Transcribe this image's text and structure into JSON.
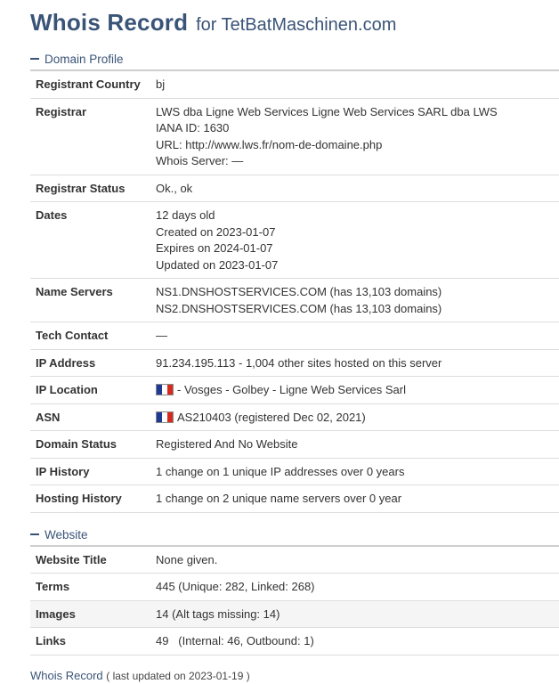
{
  "header": {
    "title": "Whois Record",
    "subtitle": "for TetBatMaschinen.com"
  },
  "domain_profile": {
    "heading": "Domain Profile",
    "rows": {
      "registrant_country": {
        "label": "Registrant Country",
        "value": "bj"
      },
      "registrar": {
        "label": "Registrar",
        "lines": [
          "LWS dba Ligne Web Services Ligne Web Services SARL dba LWS",
          "IANA ID: 1630",
          "URL: http://www.lws.fr/nom-de-domaine.php",
          "Whois Server: —"
        ]
      },
      "registrar_status": {
        "label": "Registrar Status",
        "value": "Ok., ok"
      },
      "dates": {
        "label": "Dates",
        "lines": [
          "12 days old",
          "Created on 2023-01-07",
          "Expires on 2024-01-07",
          "Updated on 2023-01-07"
        ]
      },
      "name_servers": {
        "label": "Name Servers",
        "lines": [
          "NS1.DNSHOSTSERVICES.COM (has 13,103 domains)",
          "NS2.DNSHOSTSERVICES.COM (has 13,103 domains)"
        ]
      },
      "tech_contact": {
        "label": "Tech Contact",
        "value": "—"
      },
      "ip_address": {
        "label": "IP Address",
        "value": "91.234.195.113 - 1,004 other sites hosted on this server"
      },
      "ip_location": {
        "label": "IP Location",
        "value": "- Vosges - Golbey - Ligne Web Services Sarl",
        "flag": "france-flag-icon"
      },
      "asn": {
        "label": "ASN",
        "value": "AS210403 (registered Dec 02, 2021)",
        "flag": "france-flag-icon"
      },
      "domain_status": {
        "label": "Domain Status",
        "value": "Registered And No Website"
      },
      "ip_history": {
        "label": "IP History",
        "value": "1 change on 1 unique IP addresses over 0 years"
      },
      "hosting_history": {
        "label": "Hosting History",
        "value": "1 change on 2 unique name servers over 0 year"
      }
    }
  },
  "website": {
    "heading": "Website",
    "rows": {
      "website_title": {
        "label": "Website Title",
        "value": "None given."
      },
      "terms": {
        "label": "Terms",
        "value": "445 (Unique: 282, Linked: 268)"
      },
      "images": {
        "label": "Images",
        "value": "14 (Alt tags missing: 14)"
      },
      "links": {
        "label": "Links",
        "value": "49   (Internal: 46, Outbound: 1)"
      }
    }
  },
  "footer": {
    "link": "Whois Record",
    "meta": "( last updated on 2023-01-19 )"
  },
  "colors": {
    "heading": "#3a5478",
    "flag_blue": "#1f3a93",
    "flag_red": "#d52b1e"
  }
}
